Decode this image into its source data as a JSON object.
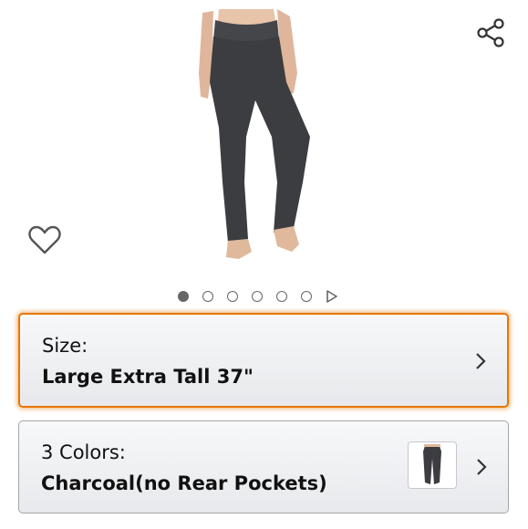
{
  "product": {
    "image_icon": "yoga-pants-product-photo",
    "dots_count": 6,
    "active_dot": 0
  },
  "icons": {
    "share": "share-icon",
    "wishlist": "heart-icon",
    "next_media": "play-triangle-icon"
  },
  "size_option": {
    "label": "Size:",
    "value": "Large Extra Tall 37\""
  },
  "color_option": {
    "label": "3 Colors:",
    "value": "Charcoal(no Rear Pockets)"
  },
  "colors": {
    "focus_border": "#e77600",
    "pants": "#3c3d40"
  }
}
